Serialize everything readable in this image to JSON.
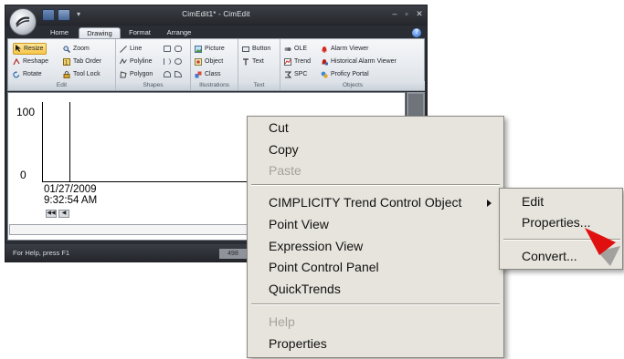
{
  "window": {
    "title": "CimEdit1* - CimEdit",
    "controls": {
      "minimize": "–",
      "maximize": "▫",
      "close": "✕"
    },
    "tabs": [
      "Home",
      "Drawing",
      "Format",
      "Arrange"
    ],
    "help_symbol": "?"
  },
  "ribbon": {
    "groups": {
      "edit": {
        "label": "Edit",
        "buttons": [
          "Resize",
          "Zoom",
          "Reshape",
          "Tab Order",
          "Rotate",
          "Tool Lock"
        ]
      },
      "shapes": {
        "label": "Shapes",
        "buttons": [
          "Line",
          "Polyline",
          "Polygon"
        ]
      },
      "illustrations": {
        "label": "Illustrations",
        "buttons": [
          "Picture",
          "Object",
          "Class"
        ]
      },
      "text": {
        "label": "Text",
        "buttons": [
          "Button",
          "Text"
        ]
      },
      "objects": {
        "label": "Objects",
        "buttons": [
          "OLE",
          "Alarm Viewer",
          "Trend",
          "Historical Alarm Viewer",
          "SPC",
          "Proficy Portal"
        ]
      }
    }
  },
  "trend": {
    "y_max": "100",
    "y_min": "0",
    "date": "01/27/2009",
    "time": "9:32:54 AM",
    "nav": {
      "first": "◀◀",
      "prev": "◀"
    }
  },
  "status": {
    "text": "For Help, press F1",
    "box": "498"
  },
  "context_menu": {
    "items": [
      {
        "label": "Cut",
        "enabled": true
      },
      {
        "label": "Copy",
        "enabled": true
      },
      {
        "label": "Paste",
        "enabled": false
      },
      {
        "label": "CIMPLICITY Trend Control Object",
        "enabled": true,
        "submenu": true
      },
      {
        "label": "Point View",
        "enabled": true
      },
      {
        "label": "Expression View",
        "enabled": true
      },
      {
        "label": "Point Control Panel",
        "enabled": true
      },
      {
        "label": "QuickTrends",
        "enabled": true
      },
      {
        "label": "Help",
        "enabled": false
      },
      {
        "label": "Properties",
        "enabled": true
      }
    ]
  },
  "submenu": {
    "items": [
      "Edit",
      "Properties...",
      "Convert..."
    ]
  },
  "colors": {
    "chrome_dark": "#2a2d33",
    "menu_bg": "#e6e4dc",
    "ribbon_selected": "#f8c545",
    "pointer_arrow": "#e01010"
  }
}
